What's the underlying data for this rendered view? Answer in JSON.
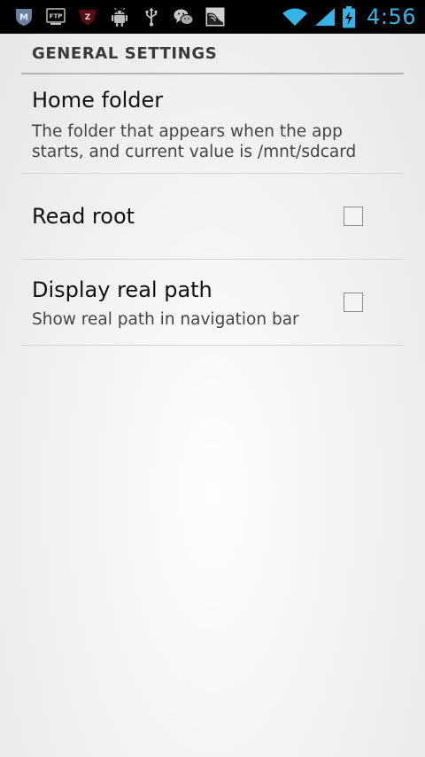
{
  "status_bar": {
    "time": "4:56",
    "notification_icons": [
      "malwarebytes-icon",
      "ftp-icon",
      "zedge-icon",
      "android-debug-icon",
      "usb-icon",
      "wechat-icon",
      "gallery-icon"
    ],
    "ftp_label": "FTP",
    "z_label": "Z",
    "m_label": "M",
    "accent_color": "#33b5e5"
  },
  "settings": {
    "category_title": "GENERAL SETTINGS",
    "items": [
      {
        "title": "Home folder",
        "summary": "The folder that appears when the app starts, and current value is /mnt/sdcard"
      },
      {
        "title": "Read root",
        "checked": false
      },
      {
        "title": "Display real path",
        "summary": "Show real path in navigation bar",
        "checked": false
      }
    ]
  }
}
